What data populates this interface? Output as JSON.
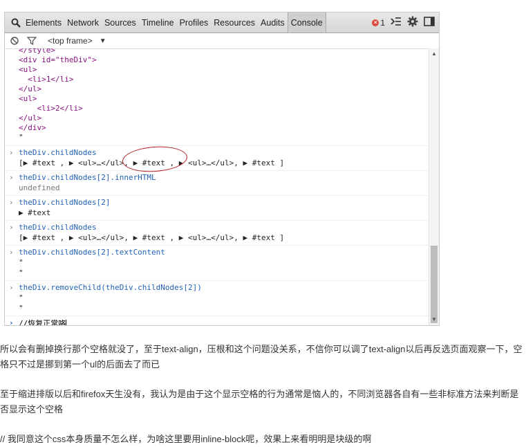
{
  "devtools": {
    "tabs": [
      "Elements",
      "Network",
      "Sources",
      "Timeline",
      "Profiles",
      "Resources",
      "Audits",
      "Console"
    ],
    "active_tab": "Console",
    "error_count": "1",
    "frame_selector": "<top frame>",
    "html_output": [
      "</style>",
      "<div id=\"theDiv\">",
      "<ul>",
      "  <li>1</li>",
      "</ul>",
      "<ul>",
      "    <li>2</li>",
      "</ul>",
      "</div>",
      "\""
    ],
    "entries": [
      {
        "command": "theDiv.childNodes",
        "result": "[▶ #text , ▶ <ul>…</ul>, ▶ #text , ▶ <ul>…</ul>, ▶ #text ]"
      },
      {
        "command": "theDiv.childNodes[2].innerHTML",
        "result": "undefined"
      },
      {
        "command": "theDiv.childNodes[2]",
        "result": "▶ #text"
      },
      {
        "command": "theDiv.childNodes",
        "result": "[▶ #text , ▶ <ul>…</ul>, ▶ #text , ▶ <ul>…</ul>, ▶ #text ]"
      },
      {
        "command": "theDiv.childNodes[2].textContent",
        "result": "\"\n\""
      },
      {
        "command": "theDiv.removeChild(theDiv.childNodes[2])",
        "result": "\"\n\""
      }
    ],
    "input_value": "//恢复正常咯"
  },
  "article": {
    "paragraphs": [
      "所以会有删掉换行那个空格就没了，至于text-align，压根和这个问题没关系，不信你可以调了text-align以后再反选页面观察一下，空格只不过是挪到第一个ul的后面去了而已",
      "至于缩进排版以后和firefox天生没有，我认为是由于这个显示空格的行为通常是恼人的，不同浏览器各自有一些非标准方法来判断是否显示这个空格",
      "// 我同意这个css本身质量不怎么样，为啥这里要用inline-block呢，效果上来看明明是块级的啊"
    ]
  }
}
